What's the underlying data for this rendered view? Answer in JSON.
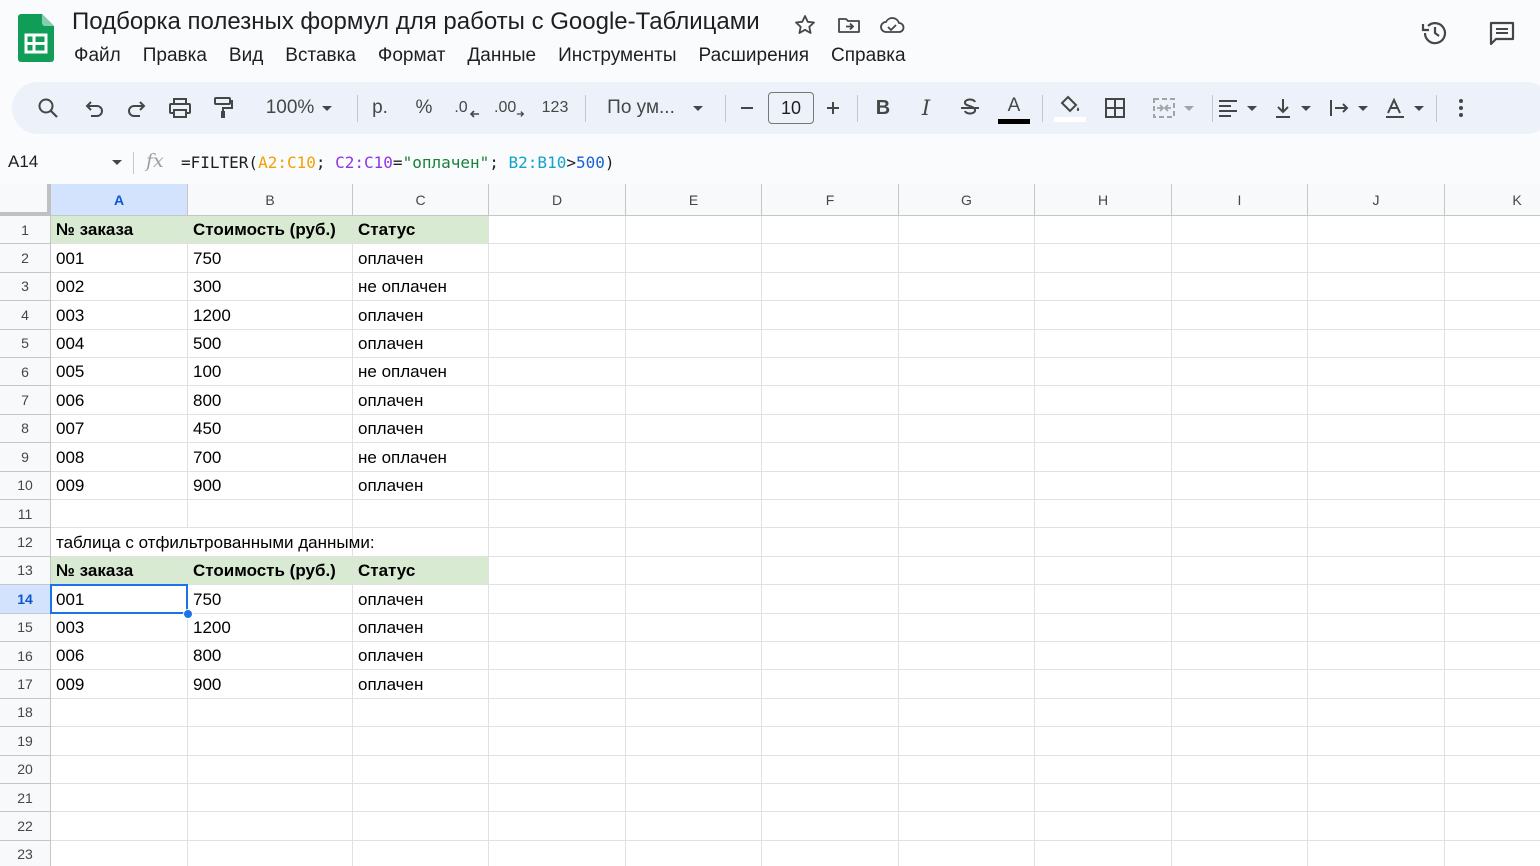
{
  "doc": {
    "title": "Подборка полезных формул для работы с Google-Таблицами"
  },
  "menu": [
    "Файл",
    "Правка",
    "Вид",
    "Вставка",
    "Формат",
    "Данные",
    "Инструменты",
    "Расширения",
    "Справка"
  ],
  "toolbar": {
    "zoom": "100%",
    "currency": "р.",
    "percent": "%",
    "dec_decrease": ".0",
    "dec_increase": ".00",
    "number_format": "123",
    "font": "По ум...",
    "font_size": "10",
    "text_color": "#000000"
  },
  "formula_bar": {
    "cell_ref": "A14",
    "parts": [
      {
        "text": "=FILTER(",
        "color": "#1f1f1f"
      },
      {
        "text": "A2:C10",
        "color": "#f4a100"
      },
      {
        "text": "; ",
        "color": "#1f1f1f"
      },
      {
        "text": "C2:C10",
        "color": "#9334e6"
      },
      {
        "text": "=",
        "color": "#1f1f1f"
      },
      {
        "text": "\"оплачен\"",
        "color": "#188038"
      },
      {
        "text": "; ",
        "color": "#1f1f1f"
      },
      {
        "text": "B2:B10",
        "color": "#12a4c6"
      },
      {
        "text": ">",
        "color": "#1f1f1f"
      },
      {
        "text": "500",
        "color": "#1a5fd6"
      },
      {
        "text": ")",
        "color": "#1f1f1f"
      }
    ]
  },
  "grid": {
    "columns": [
      "A",
      "B",
      "C",
      "D",
      "E",
      "F",
      "G",
      "H",
      "I",
      "J",
      "K"
    ],
    "selected_col": "A",
    "selected_row": 14,
    "rows": [
      {
        "num": 1,
        "cells": [
          "№ заказа",
          "Стоимость (руб.)",
          "Статус"
        ],
        "header": true
      },
      {
        "num": 2,
        "cells": [
          "001",
          "750",
          "оплачен"
        ]
      },
      {
        "num": 3,
        "cells": [
          "002",
          "300",
          "не оплачен"
        ]
      },
      {
        "num": 4,
        "cells": [
          "003",
          "1200",
          "оплачен"
        ]
      },
      {
        "num": 5,
        "cells": [
          "004",
          "500",
          "оплачен"
        ]
      },
      {
        "num": 6,
        "cells": [
          "005",
          "100",
          "не оплачен"
        ]
      },
      {
        "num": 7,
        "cells": [
          "006",
          "800",
          "оплачен"
        ]
      },
      {
        "num": 8,
        "cells": [
          "007",
          "450",
          "оплачен"
        ]
      },
      {
        "num": 9,
        "cells": [
          "008",
          "700",
          "не оплачен"
        ]
      },
      {
        "num": 10,
        "cells": [
          "009",
          "900",
          "оплачен"
        ]
      },
      {
        "num": 11,
        "cells": []
      },
      {
        "num": 12,
        "cells": [
          "таблица с отфильтрованными данными:"
        ]
      },
      {
        "num": 13,
        "cells": [
          "№ заказа",
          "Стоимость (руб.)",
          "Статус"
        ],
        "header": true
      },
      {
        "num": 14,
        "cells": [
          "001",
          "750",
          "оплачен"
        ]
      },
      {
        "num": 15,
        "cells": [
          "003",
          "1200",
          "оплачен"
        ]
      },
      {
        "num": 16,
        "cells": [
          "006",
          "800",
          "оплачен"
        ]
      },
      {
        "num": 17,
        "cells": [
          "009",
          "900",
          "оплачен"
        ]
      },
      {
        "num": 18,
        "cells": []
      },
      {
        "num": 19,
        "cells": []
      },
      {
        "num": 20,
        "cells": []
      },
      {
        "num": 21,
        "cells": []
      },
      {
        "num": 22,
        "cells": []
      },
      {
        "num": 23,
        "cells": []
      }
    ]
  }
}
